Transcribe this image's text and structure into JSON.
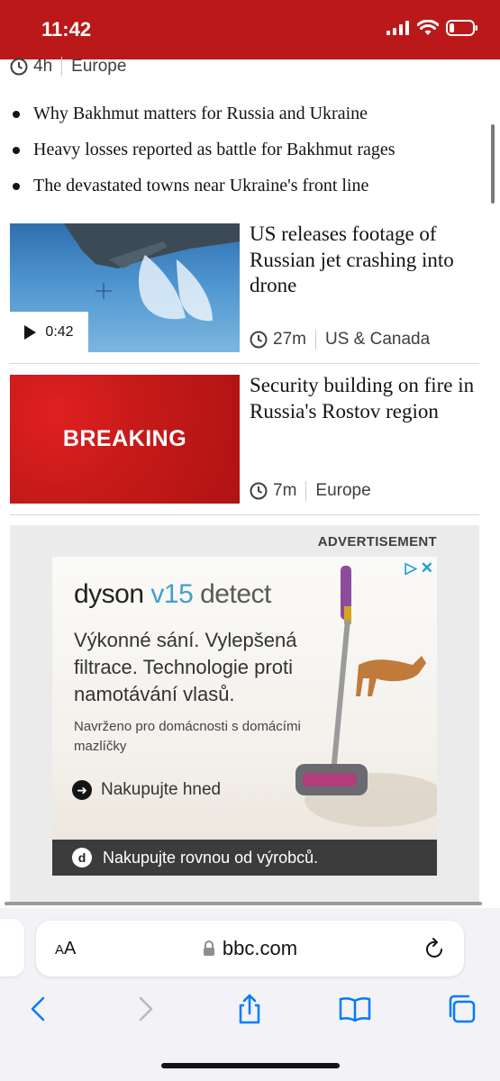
{
  "status_bar": {
    "time": "11:42"
  },
  "top_story_meta": {
    "age": "4h",
    "section": "Europe"
  },
  "related_links": [
    "Why Bakhmut matters for Russia and Ukraine",
    "Heavy losses reported as battle for Bakhmut rages",
    "The devastated towns near Ukraine's front line"
  ],
  "stories": [
    {
      "headline": "US releases footage of Russian jet crashing into drone",
      "duration": "0:42",
      "age": "27m",
      "section": "US & Canada"
    },
    {
      "headline": "Security building on fire in Russia's Rostov region",
      "thumb_label": "BREAKING",
      "age": "7m",
      "section": "Europe"
    }
  ],
  "ad": {
    "label": "ADVERTISEMENT",
    "brand_word": "dyson",
    "brand_model": "v15",
    "brand_detect": "detect",
    "main_copy": "Výkonné sání. Vylepšená filtrace. Technologie proti namotávání vlasů.",
    "sub_copy": "Navrženo pro domácnosti s domácími mazlíčky",
    "cta": "Nakupujte hned",
    "footer_icon": "d",
    "footer": "Nakupujte rovnou od výrobců."
  },
  "browser": {
    "text_size_label_big": "A",
    "text_size_label_small": "A",
    "url": "bbc.com"
  },
  "colors": {
    "bbc_red": "#bb1919",
    "link_blue": "#007aff",
    "ad_blue": "#1e9bd7"
  }
}
